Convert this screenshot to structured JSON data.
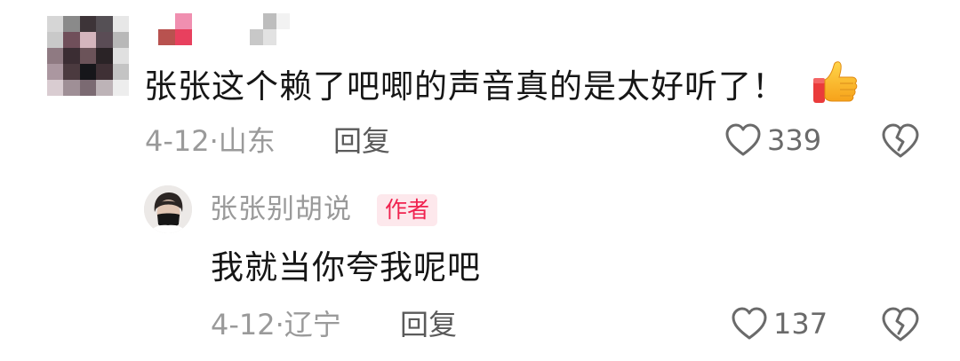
{
  "comment": {
    "text": "张张这个赖了吧唧的声音真的是太好听了！",
    "emoji": "thumbs-up",
    "date": "4-12",
    "separator": "·",
    "location": "山东",
    "reply_label": "回复",
    "like_count": "339"
  },
  "reply": {
    "author_name": "张张别胡说",
    "author_badge": "作者",
    "text": "我就当你夸我呢吧",
    "date": "4-12",
    "separator": "·",
    "location": "辽宁",
    "reply_label": "回复",
    "like_count": "137"
  },
  "colors": {
    "badge_text": "#f0224f",
    "badge_bg": "#fde8ec",
    "muted_text": "#9a9a9a",
    "body_text": "#161616"
  }
}
